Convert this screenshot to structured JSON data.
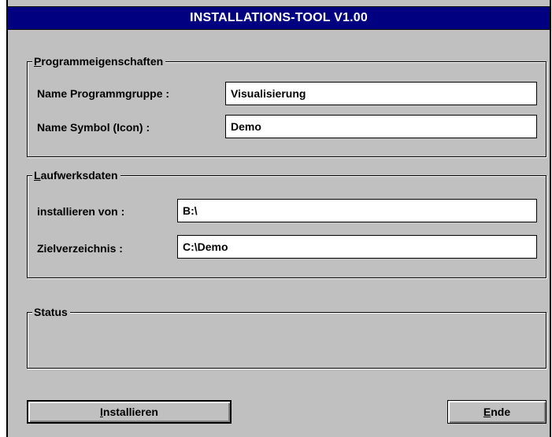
{
  "window": {
    "title": "INSTALLATIONS-TOOL V1.00"
  },
  "program_group": {
    "legend_first": "P",
    "legend_rest": "rogrammeigenschaften",
    "group_name_label": "Name Programmgruppe :",
    "group_name_value": "Visualisierung",
    "icon_name_label": "Name Symbol (Icon) :",
    "icon_name_value": "Demo"
  },
  "drive_data": {
    "legend_first": "L",
    "legend_rest": "aufwerksdaten",
    "install_from_label": "installieren von :",
    "install_from_value": "B:\\",
    "target_dir_label": "Zielverzeichnis :",
    "target_dir_value": "C:\\Demo"
  },
  "status": {
    "legend": "Status"
  },
  "buttons": {
    "install_first": "I",
    "install_rest": "nstallieren",
    "end_first": "E",
    "end_rest": "nde"
  }
}
